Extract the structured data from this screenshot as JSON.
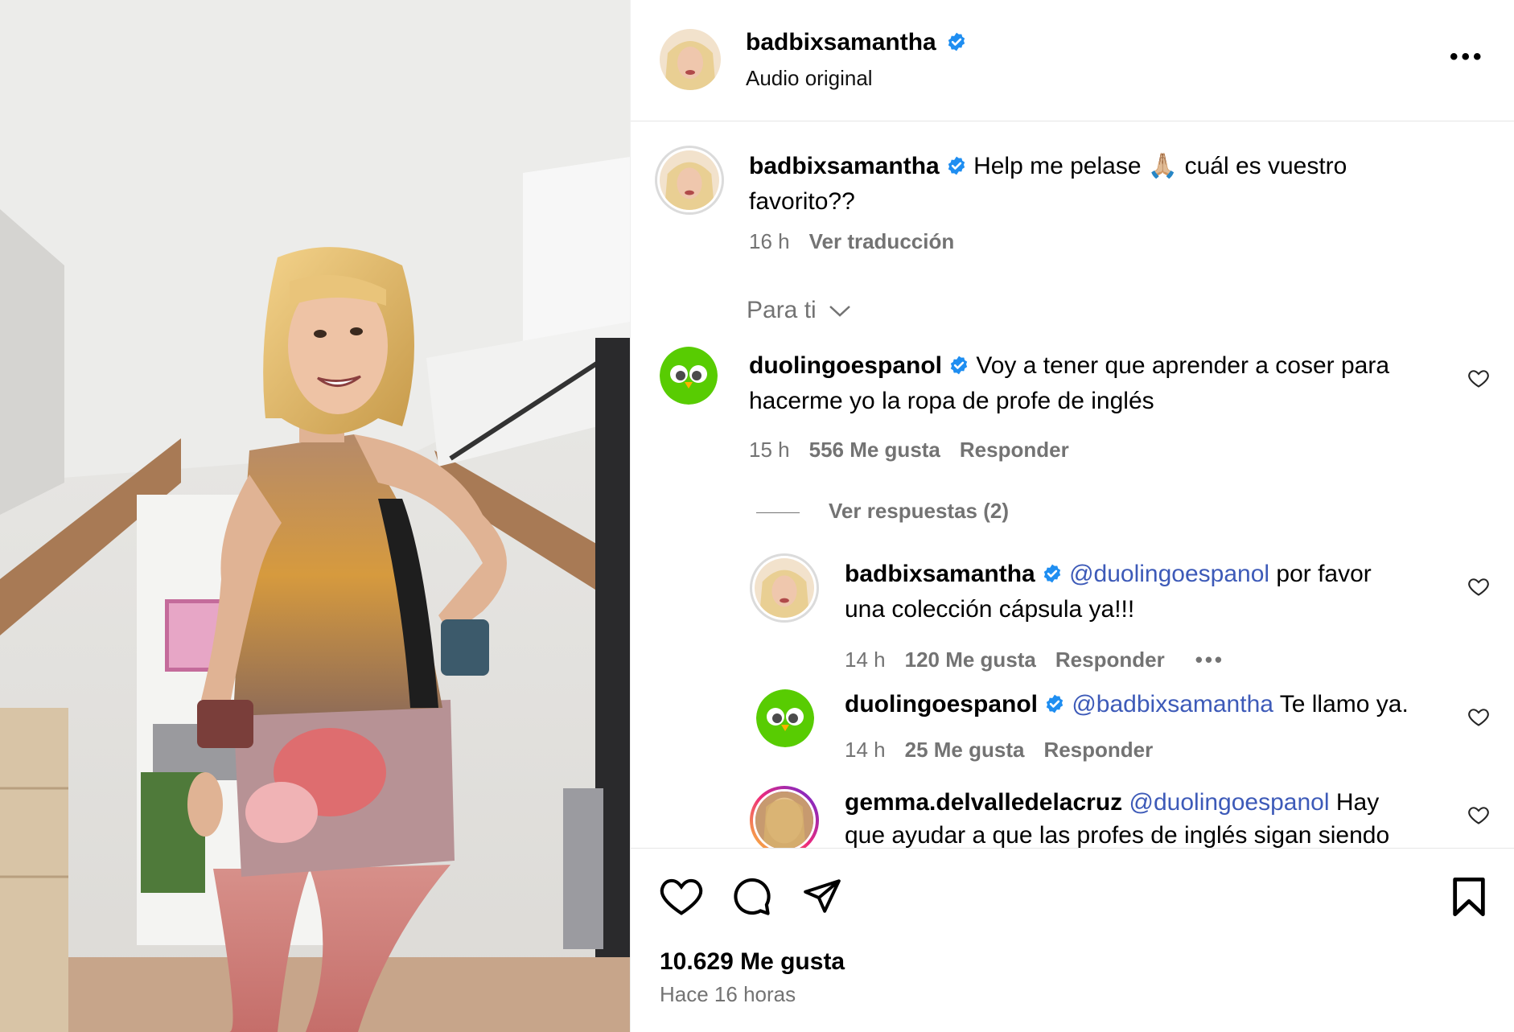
{
  "post": {
    "author": "badbixsamantha",
    "audio": "Audio original",
    "caption": {
      "username": "badbixsamantha",
      "text_before_emoji": "Help me pelase",
      "emoji": "🙏🏼",
      "text_after_emoji": "cuál es vuestro",
      "text_line2": "favorito??",
      "time": "16 h",
      "translate": "Ver traducción"
    },
    "sort_label": "Para ti",
    "likes": "10.629 Me gusta",
    "posted": "Hace 16 horas"
  },
  "comments": [
    {
      "username": "duolingoespanol",
      "line1": "Voy a tener que aprender a coser para",
      "line2": "hacerme yo la ropa de profe de inglés",
      "time": "15 h",
      "likes": "556 Me gusta",
      "reply": "Responder",
      "view_replies": "Ver respuestas (2)"
    },
    {
      "username": "badbixsamantha",
      "mention": "@duolingoespanol",
      "line1": "por favor",
      "line2": "una colección cápsula ya!!!",
      "time": "14 h",
      "likes": "120 Me gusta",
      "reply": "Responder"
    },
    {
      "username": "duolingoespanol",
      "mention": "@badbixsamantha",
      "line1": "Te llamo ya.",
      "time": "14 h",
      "likes": "25 Me gusta",
      "reply": "Responder"
    },
    {
      "username": "gemma.delvalledelacruz",
      "mention": "@duolingoespanol",
      "line1": "Hay",
      "line2": "que ayudar a que las profes de inglés sigan siendo"
    }
  ],
  "colors": {
    "verified": "#1f8ef1",
    "mention": "#3d5ab8",
    "secondary_text": "#737373",
    "duolingo_green": "#58cc02"
  },
  "icons": [
    "verified-badge-icon",
    "more-options-icon",
    "chevron-down-icon",
    "heart-icon",
    "comment-icon",
    "share-icon",
    "bookmark-icon"
  ]
}
